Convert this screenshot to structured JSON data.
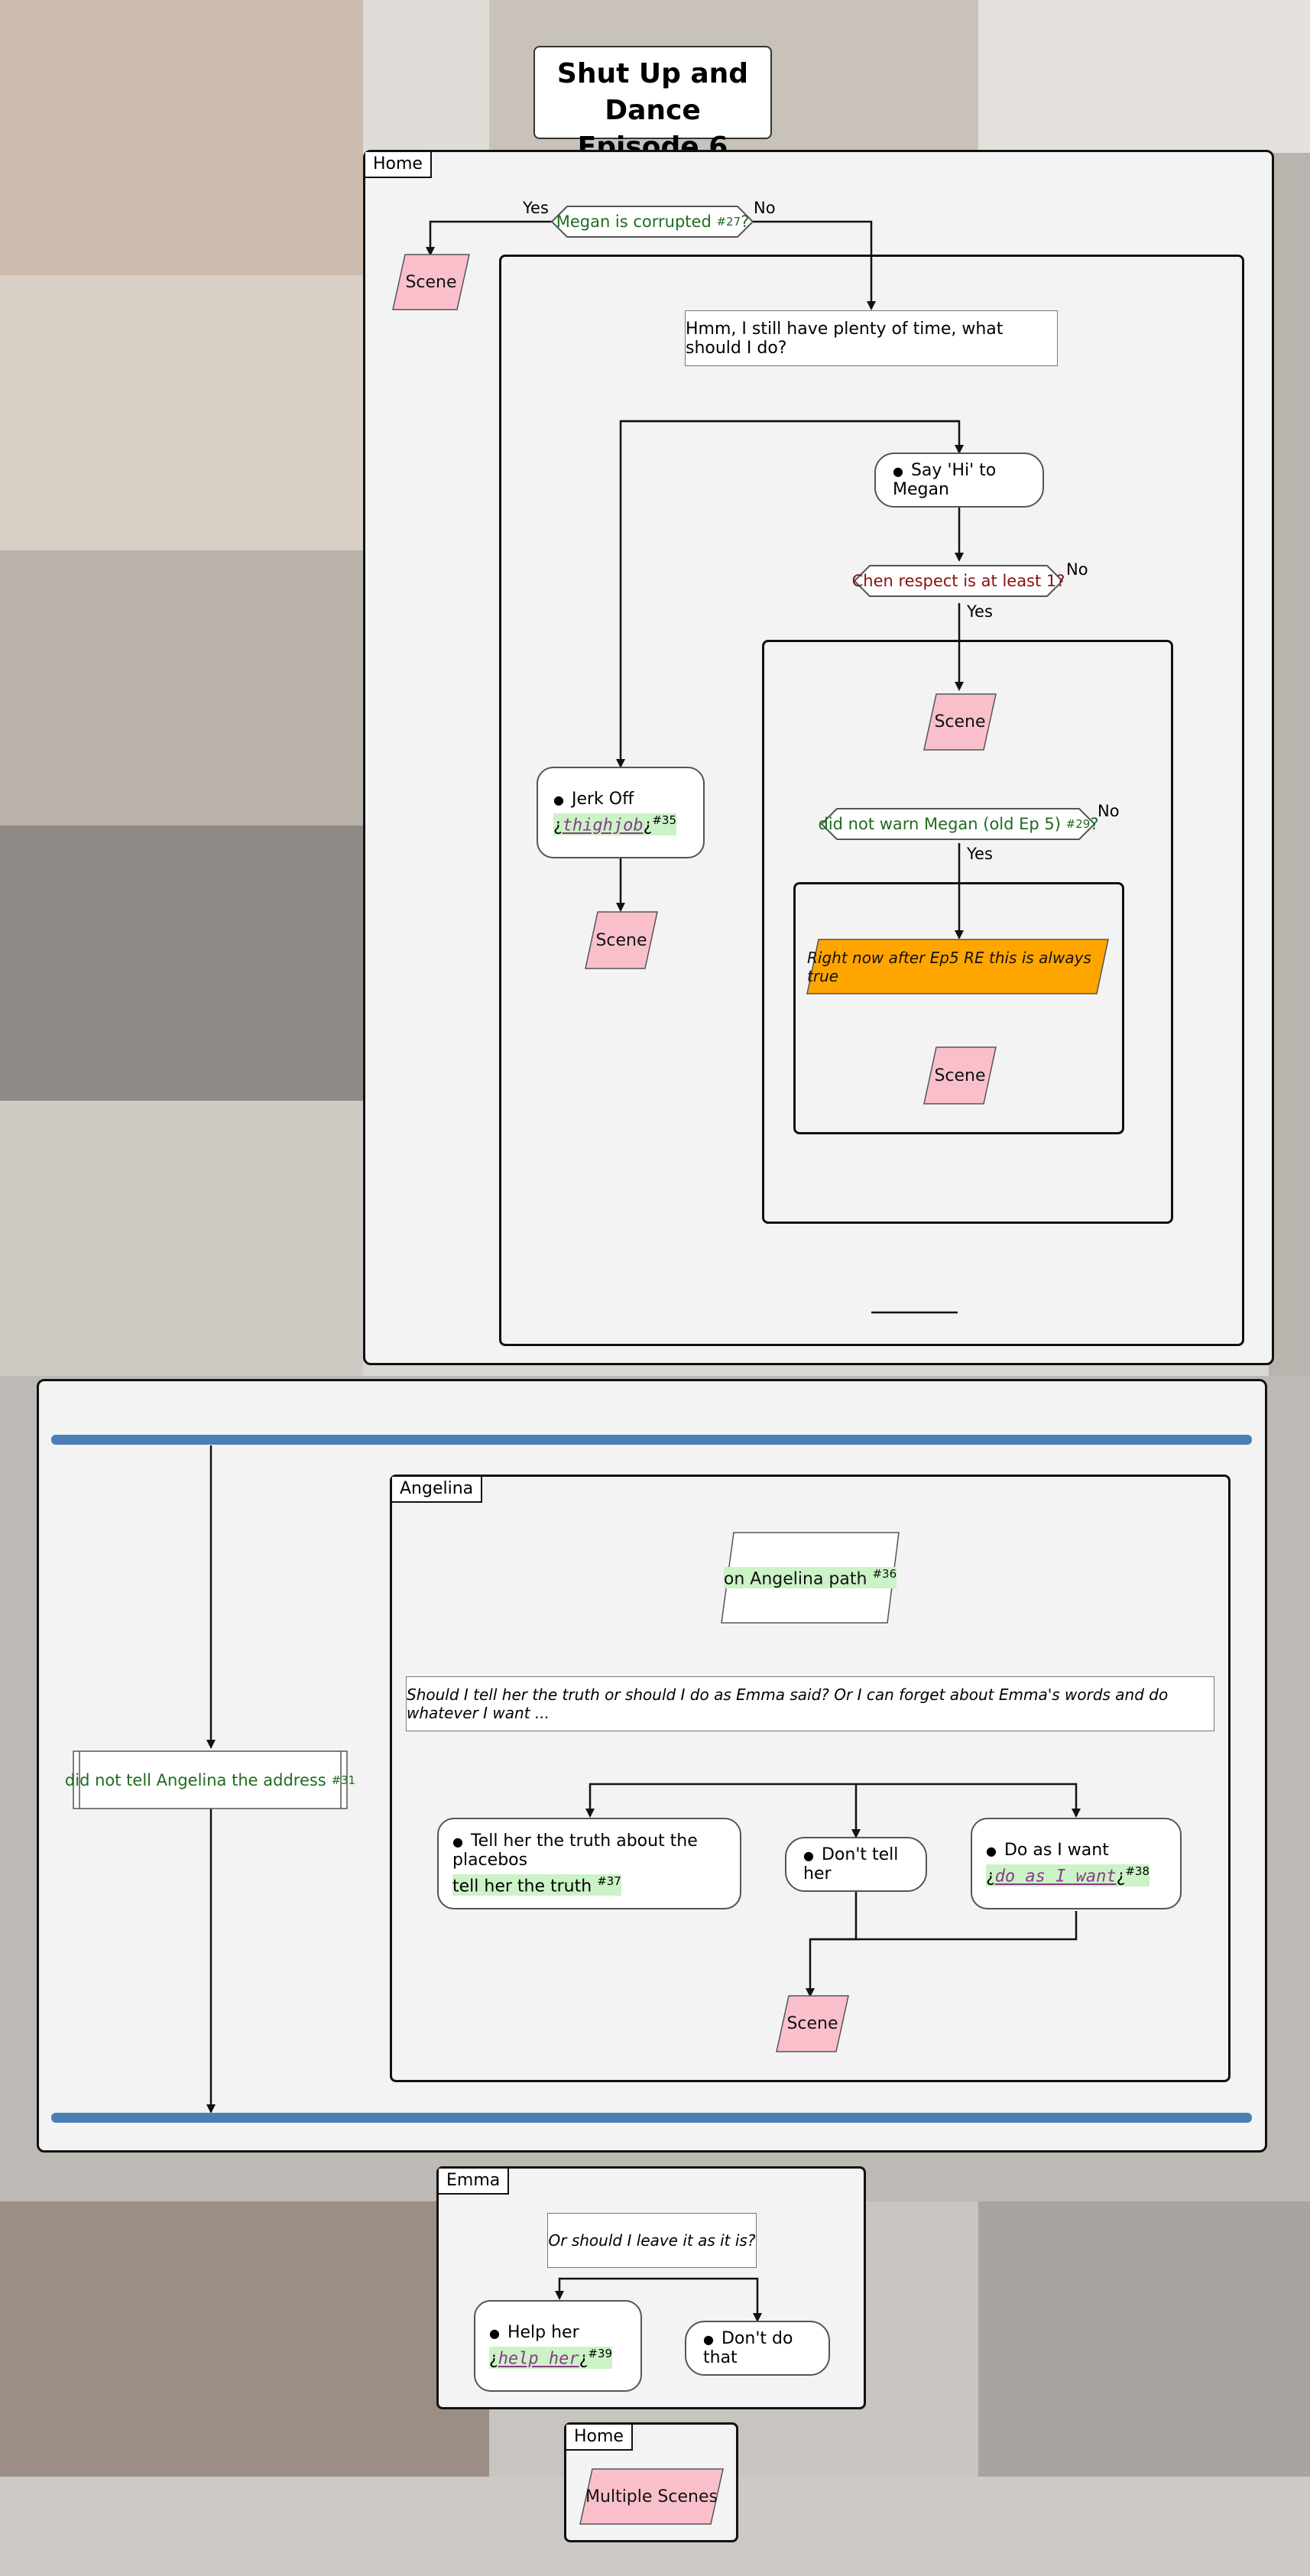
{
  "title": {
    "line1": "Shut Up and Dance",
    "line2": "Episode 6"
  },
  "sections": {
    "home1": "Home",
    "angelina": "Angelina",
    "emma": "Emma",
    "home2": "Home"
  },
  "home1": {
    "cond_megan": {
      "text": "Megan is corrupted",
      "ref": "#27",
      "suffix": "?",
      "yes": "Yes",
      "no": "No"
    },
    "scene_left": "Scene",
    "question": "Hmm, I still have plenty of time, what should I do?",
    "say_hi": "Say 'Hi' to Megan",
    "cond_chen": {
      "text": "Chen respect is at least 1?",
      "no": "No",
      "yes": "Yes"
    },
    "scene_chen": "Scene",
    "cond_warn": {
      "text": "did not warn Megan (old Ep 5)",
      "ref": "#29",
      "suffix": "?",
      "no": "No",
      "yes": "Yes"
    },
    "note_orange": "Right now after Ep5 RE this is always true",
    "scene_warn": "Scene",
    "jerk_off": {
      "label": "Jerk Off",
      "code": "thighjob",
      "ref": "#35"
    },
    "scene_jerk": "Scene"
  },
  "fork": {
    "cond_address": {
      "text": "did not tell Angelina the address",
      "ref": "#31"
    }
  },
  "angelina": {
    "path": {
      "text": "on Angelina path",
      "ref": "#36"
    },
    "question": "Should I tell her the truth or should I do as Emma said? Or I can forget about Emma's words and do whatever I want ...",
    "opt_truth": {
      "label": "Tell her the truth about the placebos",
      "tag": "tell her the truth",
      "ref": "#37"
    },
    "opt_dont": "Don't tell her",
    "opt_want": {
      "label": "Do as I want",
      "code": "do as I want",
      "ref": "#38"
    },
    "scene": "Scene"
  },
  "emma": {
    "question": "Or should I leave it as it is?",
    "help": {
      "label": "Help her",
      "code": "help her",
      "ref": "#39"
    },
    "dont": "Don't do that"
  },
  "home2": {
    "scenes": "Multiple Scenes"
  },
  "colors": {
    "scene_fill": "#f9c0cb",
    "orange_fill": "#ffa500",
    "bar": "#4a7fb5",
    "green_text": "#1f6b1f",
    "red_text": "#8a1010"
  }
}
